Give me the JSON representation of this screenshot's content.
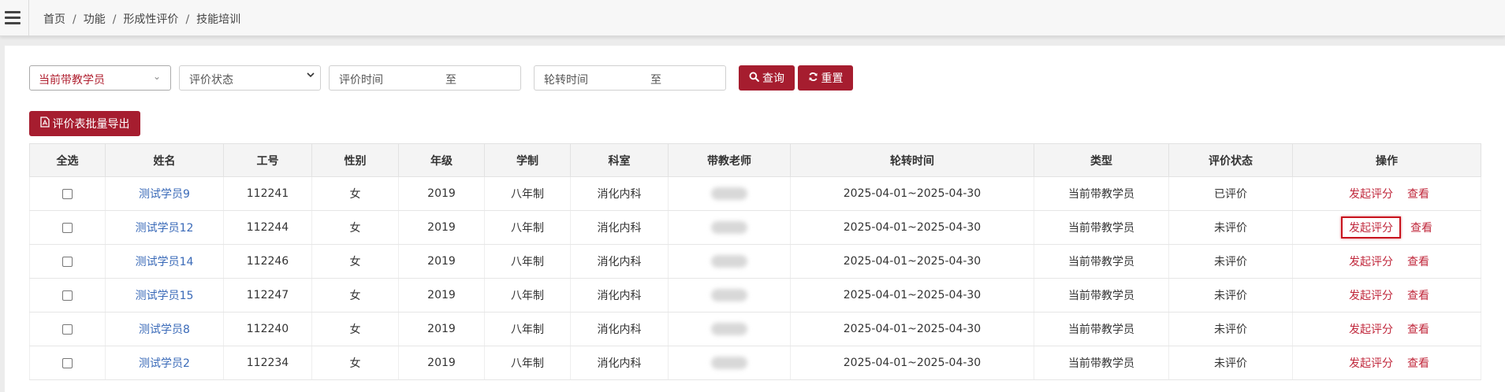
{
  "breadcrumb": {
    "items": [
      "首页",
      "功能",
      "形成性评价",
      "技能培训"
    ],
    "separator": "/"
  },
  "filters": {
    "mentor_select": {
      "value": "当前带教学员",
      "icon": "chevron-down-icon"
    },
    "status_select": {
      "placeholder": "评价状态",
      "icon": "chevron-down-icon"
    },
    "eval_time": {
      "label": "评价时间",
      "to": "至"
    },
    "rotation_time": {
      "label": "轮转时间",
      "to": "至"
    }
  },
  "buttons": {
    "query": {
      "label": "查询",
      "icon": "search-icon"
    },
    "reset": {
      "label": "重置",
      "icon": "refresh-icon"
    },
    "export": {
      "label": "评价表批量导出",
      "icon": "pdf-icon"
    }
  },
  "table": {
    "headers": [
      "全选",
      "姓名",
      "工号",
      "性别",
      "年级",
      "学制",
      "科室",
      "带教老师",
      "轮转时间",
      "类型",
      "评价状态",
      "操作"
    ],
    "rows": [
      {
        "name": "测试学员9",
        "id": "112241",
        "gender": "女",
        "grade": "2019",
        "system": "八年制",
        "dept": "消化内科",
        "period": "2025-04-01~2025-04-30",
        "type": "当前带教学员",
        "status": "已评价",
        "action_start": "发起评分",
        "action_view": "查看"
      },
      {
        "name": "测试学员12",
        "id": "112244",
        "gender": "女",
        "grade": "2019",
        "system": "八年制",
        "dept": "消化内科",
        "period": "2025-04-01~2025-04-30",
        "type": "当前带教学员",
        "status": "未评价",
        "action_start": "发起评分",
        "action_view": "查看"
      },
      {
        "name": "测试学员14",
        "id": "112246",
        "gender": "女",
        "grade": "2019",
        "system": "八年制",
        "dept": "消化内科",
        "period": "2025-04-01~2025-04-30",
        "type": "当前带教学员",
        "status": "未评价",
        "action_start": "发起评分",
        "action_view": "查看"
      },
      {
        "name": "测试学员15",
        "id": "112247",
        "gender": "女",
        "grade": "2019",
        "system": "八年制",
        "dept": "消化内科",
        "period": "2025-04-01~2025-04-30",
        "type": "当前带教学员",
        "status": "未评价",
        "action_start": "发起评分",
        "action_view": "查看"
      },
      {
        "name": "测试学员8",
        "id": "112240",
        "gender": "女",
        "grade": "2019",
        "system": "八年制",
        "dept": "消化内科",
        "period": "2025-04-01~2025-04-30",
        "type": "当前带教学员",
        "status": "未评价",
        "action_start": "发起评分",
        "action_view": "查看"
      },
      {
        "name": "测试学员2",
        "id": "112234",
        "gender": "女",
        "grade": "2019",
        "system": "八年制",
        "dept": "消化内科",
        "period": "2025-04-01~2025-04-30",
        "type": "当前带教学员",
        "status": "未评价",
        "action_start": "发起评分",
        "action_view": "查看"
      }
    ]
  },
  "colors": {
    "accent": "#a61d2f",
    "link_blue": "#3a6ab8",
    "action_red": "#c0283c"
  }
}
